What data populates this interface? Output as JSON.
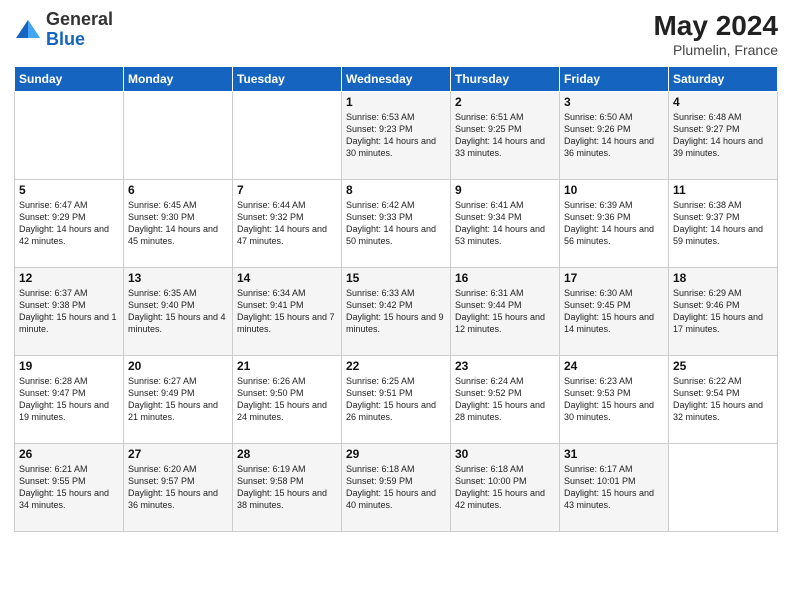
{
  "header": {
    "logo_general": "General",
    "logo_blue": "Blue",
    "month_year": "May 2024",
    "location": "Plumelin, France"
  },
  "days_of_week": [
    "Sunday",
    "Monday",
    "Tuesday",
    "Wednesday",
    "Thursday",
    "Friday",
    "Saturday"
  ],
  "weeks": [
    [
      {
        "day": "",
        "info": ""
      },
      {
        "day": "",
        "info": ""
      },
      {
        "day": "",
        "info": ""
      },
      {
        "day": "1",
        "info": "Sunrise: 6:53 AM\nSunset: 9:23 PM\nDaylight: 14 hours\nand 30 minutes."
      },
      {
        "day": "2",
        "info": "Sunrise: 6:51 AM\nSunset: 9:25 PM\nDaylight: 14 hours\nand 33 minutes."
      },
      {
        "day": "3",
        "info": "Sunrise: 6:50 AM\nSunset: 9:26 PM\nDaylight: 14 hours\nand 36 minutes."
      },
      {
        "day": "4",
        "info": "Sunrise: 6:48 AM\nSunset: 9:27 PM\nDaylight: 14 hours\nand 39 minutes."
      }
    ],
    [
      {
        "day": "5",
        "info": "Sunrise: 6:47 AM\nSunset: 9:29 PM\nDaylight: 14 hours\nand 42 minutes."
      },
      {
        "day": "6",
        "info": "Sunrise: 6:45 AM\nSunset: 9:30 PM\nDaylight: 14 hours\nand 45 minutes."
      },
      {
        "day": "7",
        "info": "Sunrise: 6:44 AM\nSunset: 9:32 PM\nDaylight: 14 hours\nand 47 minutes."
      },
      {
        "day": "8",
        "info": "Sunrise: 6:42 AM\nSunset: 9:33 PM\nDaylight: 14 hours\nand 50 minutes."
      },
      {
        "day": "9",
        "info": "Sunrise: 6:41 AM\nSunset: 9:34 PM\nDaylight: 14 hours\nand 53 minutes."
      },
      {
        "day": "10",
        "info": "Sunrise: 6:39 AM\nSunset: 9:36 PM\nDaylight: 14 hours\nand 56 minutes."
      },
      {
        "day": "11",
        "info": "Sunrise: 6:38 AM\nSunset: 9:37 PM\nDaylight: 14 hours\nand 59 minutes."
      }
    ],
    [
      {
        "day": "12",
        "info": "Sunrise: 6:37 AM\nSunset: 9:38 PM\nDaylight: 15 hours\nand 1 minute."
      },
      {
        "day": "13",
        "info": "Sunrise: 6:35 AM\nSunset: 9:40 PM\nDaylight: 15 hours\nand 4 minutes."
      },
      {
        "day": "14",
        "info": "Sunrise: 6:34 AM\nSunset: 9:41 PM\nDaylight: 15 hours\nand 7 minutes."
      },
      {
        "day": "15",
        "info": "Sunrise: 6:33 AM\nSunset: 9:42 PM\nDaylight: 15 hours\nand 9 minutes."
      },
      {
        "day": "16",
        "info": "Sunrise: 6:31 AM\nSunset: 9:44 PM\nDaylight: 15 hours\nand 12 minutes."
      },
      {
        "day": "17",
        "info": "Sunrise: 6:30 AM\nSunset: 9:45 PM\nDaylight: 15 hours\nand 14 minutes."
      },
      {
        "day": "18",
        "info": "Sunrise: 6:29 AM\nSunset: 9:46 PM\nDaylight: 15 hours\nand 17 minutes."
      }
    ],
    [
      {
        "day": "19",
        "info": "Sunrise: 6:28 AM\nSunset: 9:47 PM\nDaylight: 15 hours\nand 19 minutes."
      },
      {
        "day": "20",
        "info": "Sunrise: 6:27 AM\nSunset: 9:49 PM\nDaylight: 15 hours\nand 21 minutes."
      },
      {
        "day": "21",
        "info": "Sunrise: 6:26 AM\nSunset: 9:50 PM\nDaylight: 15 hours\nand 24 minutes."
      },
      {
        "day": "22",
        "info": "Sunrise: 6:25 AM\nSunset: 9:51 PM\nDaylight: 15 hours\nand 26 minutes."
      },
      {
        "day": "23",
        "info": "Sunrise: 6:24 AM\nSunset: 9:52 PM\nDaylight: 15 hours\nand 28 minutes."
      },
      {
        "day": "24",
        "info": "Sunrise: 6:23 AM\nSunset: 9:53 PM\nDaylight: 15 hours\nand 30 minutes."
      },
      {
        "day": "25",
        "info": "Sunrise: 6:22 AM\nSunset: 9:54 PM\nDaylight: 15 hours\nand 32 minutes."
      }
    ],
    [
      {
        "day": "26",
        "info": "Sunrise: 6:21 AM\nSunset: 9:55 PM\nDaylight: 15 hours\nand 34 minutes."
      },
      {
        "day": "27",
        "info": "Sunrise: 6:20 AM\nSunset: 9:57 PM\nDaylight: 15 hours\nand 36 minutes."
      },
      {
        "day": "28",
        "info": "Sunrise: 6:19 AM\nSunset: 9:58 PM\nDaylight: 15 hours\nand 38 minutes."
      },
      {
        "day": "29",
        "info": "Sunrise: 6:18 AM\nSunset: 9:59 PM\nDaylight: 15 hours\nand 40 minutes."
      },
      {
        "day": "30",
        "info": "Sunrise: 6:18 AM\nSunset: 10:00 PM\nDaylight: 15 hours\nand 42 minutes."
      },
      {
        "day": "31",
        "info": "Sunrise: 6:17 AM\nSunset: 10:01 PM\nDaylight: 15 hours\nand 43 minutes."
      },
      {
        "day": "",
        "info": ""
      }
    ]
  ]
}
